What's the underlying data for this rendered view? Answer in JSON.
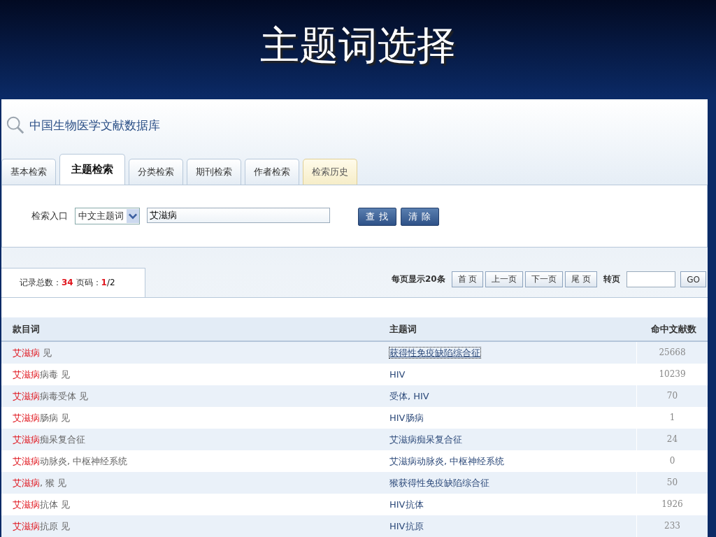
{
  "slide": {
    "title": "主题词选择"
  },
  "site": {
    "title": "中国生物医学文献数据库"
  },
  "tabs": [
    {
      "label": "基本检索",
      "selected": false,
      "kind": "normal"
    },
    {
      "label": "主题检索",
      "selected": true,
      "kind": "normal"
    },
    {
      "label": "分类检索",
      "selected": false,
      "kind": "normal"
    },
    {
      "label": "期刊检索",
      "selected": false,
      "kind": "normal"
    },
    {
      "label": "作者检索",
      "selected": false,
      "kind": "normal"
    },
    {
      "label": "检索历史",
      "selected": false,
      "kind": "history"
    }
  ],
  "search": {
    "label": "检索入口",
    "select_value": "中文主题词",
    "value": "艾滋病",
    "buttons": [
      "查 找",
      "清 除"
    ]
  },
  "results": {
    "total_label": "记录总数：",
    "total": "34",
    "page_label": "页码：",
    "page_current": "1",
    "page_total": "/2",
    "per_page": "每页显示20条",
    "pager_buttons": [
      "首 页",
      "上一页",
      "下一页",
      "尾 页"
    ],
    "goto_label": "转页",
    "go": "GO"
  },
  "table": {
    "columns": [
      "款目词",
      "主题词",
      "命中文献数"
    ],
    "rows": [
      {
        "match": "艾滋病",
        "rest": " 见",
        "subject": "获得性免疫缺陷综合征",
        "count": "25668",
        "focused": true
      },
      {
        "match": "艾滋病",
        "rest": "病毒 见",
        "subject": "HIV",
        "count": "10239",
        "focused": false
      },
      {
        "match": "艾滋病",
        "rest": "病毒受体 见",
        "subject": "受体, HIV",
        "count": "70",
        "focused": false
      },
      {
        "match": "艾滋病",
        "rest": "肠病 见",
        "subject": "HIV肠病",
        "count": "1",
        "focused": false
      },
      {
        "match": "艾滋病",
        "rest": "痴呆复合征",
        "subject": "艾滋病痴呆复合征",
        "count": "24",
        "focused": false
      },
      {
        "match": "艾滋病",
        "rest": "动脉炎, 中枢神经系统",
        "subject": "艾滋病动脉炎, 中枢神经系统",
        "count": "0",
        "focused": false
      },
      {
        "match": "艾滋病",
        "rest": ", 猴 见",
        "subject": "猴获得性免疫缺陷综合征",
        "count": "50",
        "focused": false
      },
      {
        "match": "艾滋病",
        "rest": "抗体 见",
        "subject": "HIV抗体",
        "count": "1926",
        "focused": false
      },
      {
        "match": "艾滋病",
        "rest": "抗原 见",
        "subject": "HIV抗原",
        "count": "233",
        "focused": false
      }
    ]
  }
}
